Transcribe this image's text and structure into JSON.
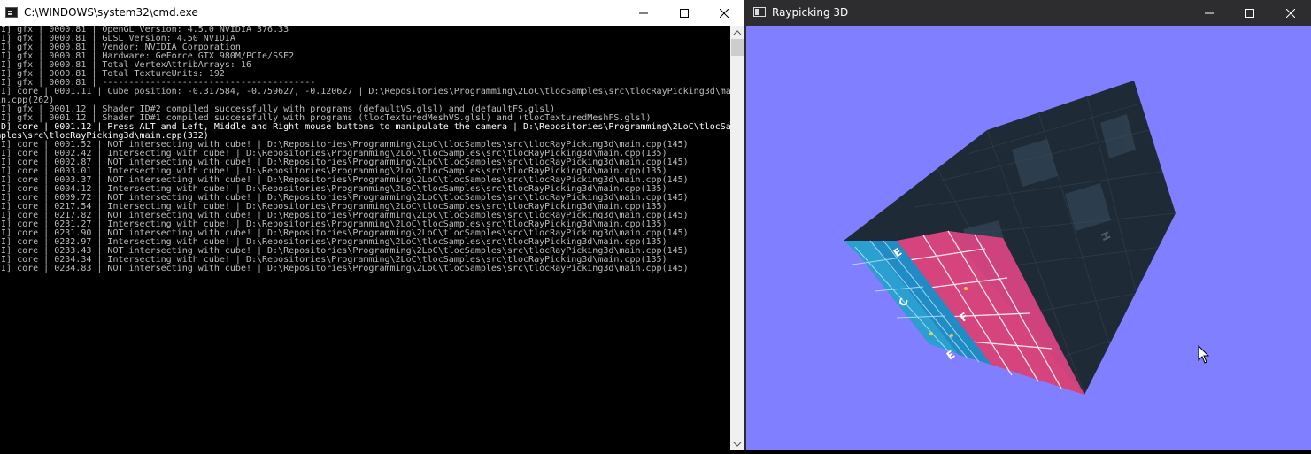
{
  "cmd_window": {
    "title": "C:\\WINDOWS\\system32\\cmd.exe",
    "console_lines": [
      "[I] gfx | 0000.81 | OpenGL Version: 4.5.0 NVIDIA 376.33",
      "[I] gfx | 0000.81 | GLSL Version: 4.50 NVIDIA",
      "[I] gfx | 0000.81 | Vendor: NVIDIA Corporation",
      "[I] gfx | 0000.81 | Hardware: GeForce GTX 980M/PCIe/SSE2",
      "[I] gfx | 0000.81 | Total VertexAttribArrays: 16",
      "[I] gfx | 0000.81 | Total TextureUnits: 192",
      "[I] gfx | 0000.81 | ----------------------------------------",
      "[I] core | 0001.11 | Cube position: -0.317584, -0.759627, -0.120627 | D:\\Repositories\\Programming\\2LoC\\tlocSamples\\src\\tlocRayPicking3d\\ma",
      "in.cpp(262)",
      "[I] gfx | 0001.12 | Shader ID#2 compiled successfully with programs (defaultVS.glsl) and (defaultFS.glsl)",
      "[I] gfx | 0001.12 | Shader ID#1 compiled successfully with programs (tlocTexturedMeshVS.glsl) and (tlocTexturedMeshFS.glsl)",
      "[D] core | 0001.12 | Press ALT and Left, Middle and Right mouse buttons to manipulate the camera | D:\\Repositories\\Programming\\2LoC\\tlocSa",
      "mples\\src\\tlocRayPicking3d\\main.cpp(332)",
      "[I] core | 0001.52 | NOT intersecting with cube! | D:\\Repositories\\Programming\\2LoC\\tlocSamples\\src\\tlocRayPicking3d\\main.cpp(145)",
      "[I] core | 0002.42 | Intersecting with cube! | D:\\Repositories\\Programming\\2LoC\\tlocSamples\\src\\tlocRayPicking3d\\main.cpp(135)",
      "[I] core | 0002.87 | NOT intersecting with cube! | D:\\Repositories\\Programming\\2LoC\\tlocSamples\\src\\tlocRayPicking3d\\main.cpp(145)",
      "[I] core | 0003.01 | Intersecting with cube! | D:\\Repositories\\Programming\\2LoC\\tlocSamples\\src\\tlocRayPicking3d\\main.cpp(135)",
      "[I] core | 0003.37 | NOT intersecting with cube! | D:\\Repositories\\Programming\\2LoC\\tlocSamples\\src\\tlocRayPicking3d\\main.cpp(145)",
      "[I] core | 0004.12 | Intersecting with cube! | D:\\Repositories\\Programming\\2LoC\\tlocSamples\\src\\tlocRayPicking3d\\main.cpp(135)",
      "[I] core | 0009.72 | NOT intersecting with cube! | D:\\Repositories\\Programming\\2LoC\\tlocSamples\\src\\tlocRayPicking3d\\main.cpp(145)",
      "[I] core | 0217.54 | Intersecting with cube! | D:\\Repositories\\Programming\\2LoC\\tlocSamples\\src\\tlocRayPicking3d\\main.cpp(135)",
      "[I] core | 0217.82 | NOT intersecting with cube! | D:\\Repositories\\Programming\\2LoC\\tlocSamples\\src\\tlocRayPicking3d\\main.cpp(145)",
      "[I] core | 0231.27 | Intersecting with cube! | D:\\Repositories\\Programming\\2LoC\\tlocSamples\\src\\tlocRayPicking3d\\main.cpp(135)",
      "[I] core | 0231.90 | NOT intersecting with cube! | D:\\Repositories\\Programming\\2LoC\\tlocSamples\\src\\tlocRayPicking3d\\main.cpp(145)",
      "[I] core | 0232.97 | Intersecting with cube! | D:\\Repositories\\Programming\\2LoC\\tlocSamples\\src\\tlocRayPicking3d\\main.cpp(135)",
      "[I] core | 0233.43 | NOT intersecting with cube! | D:\\Repositories\\Programming\\2LoC\\tlocSamples\\src\\tlocRayPicking3d\\main.cpp(145)",
      "[I] core | 0234.34 | Intersecting with cube! | D:\\Repositories\\Programming\\2LoC\\tlocSamples\\src\\tlocRayPicking3d\\main.cpp(135)",
      "[I] core | 0234.83 | NOT intersecting with cube! | D:\\Repositories\\Programming\\2LoC\\tlocSamples\\src\\tlocRayPicking3d\\main.cpp(145)"
    ],
    "highlighted_lines": [
      11,
      12
    ]
  },
  "ray_window": {
    "title": "Raypicking 3D",
    "background": "#7f7fff",
    "cube": {
      "left_face_color": "#2a9fd0",
      "front_face_color": "#e0407a",
      "top_face_color": "#1e2a36",
      "glyphs": [
        "E",
        "C",
        "F",
        "E",
        "H"
      ]
    },
    "cursor_icon": "arrow-cursor-icon"
  }
}
